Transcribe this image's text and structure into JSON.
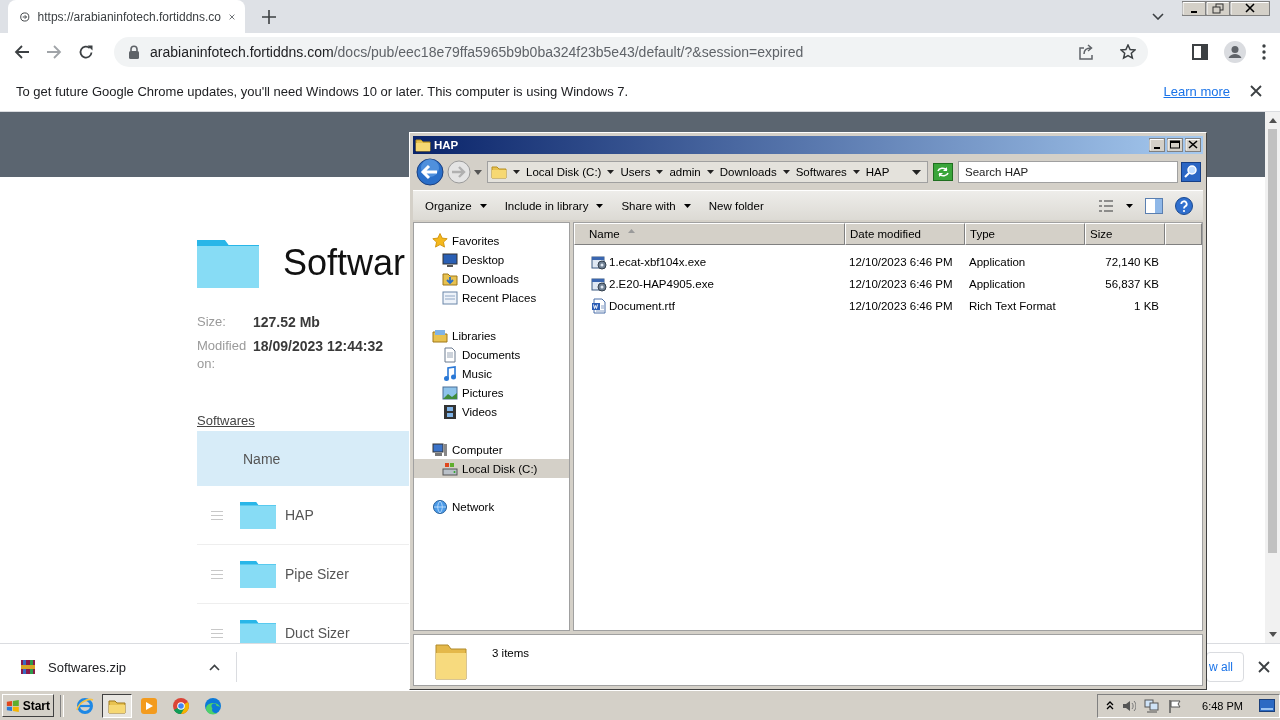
{
  "browser": {
    "tab": {
      "title": "https://arabianinfotech.fortiddns.co"
    },
    "address": {
      "host": "arabianinfotech.fortiddns.com",
      "path": "/docs/pub/eec18e79ffa5965b9b0ba324f23b5e43/default/?&session=expired"
    },
    "infobar": {
      "message": "To get future Google Chrome updates, you'll need Windows 10 or later. This computer is using Windows 7.",
      "link": "Learn more"
    }
  },
  "page": {
    "title": "Softwar",
    "size_label": "Size:",
    "size": "127.52 Mb",
    "modified_label": "Modified on:",
    "modified": "18/09/2023 12:44:32",
    "breadcrumb": "Softwares",
    "column": "Name",
    "rows": [
      {
        "name": "HAP"
      },
      {
        "name": "Pipe Sizer"
      },
      {
        "name": "Duct Sizer"
      }
    ]
  },
  "downloads": {
    "file": "Softwares.zip",
    "show_all": "w all"
  },
  "explorer": {
    "title": "HAP",
    "breadcrumb": [
      "Local Disk (C:)",
      "Users",
      "admin",
      "Downloads",
      "Softwares",
      "HAP"
    ],
    "search": {
      "placeholder": "Search HAP"
    },
    "commands": [
      {
        "label": "Organize",
        "menu": true
      },
      {
        "label": "Include in library",
        "menu": true
      },
      {
        "label": "Share with",
        "menu": true
      },
      {
        "label": "New folder",
        "menu": false
      }
    ],
    "nav": [
      {
        "label": "Favorites",
        "selected": false,
        "children": [
          {
            "label": "Desktop",
            "selected": false
          },
          {
            "label": "Downloads",
            "selected": false
          },
          {
            "label": "Recent Places",
            "selected": false
          }
        ]
      },
      {
        "label": "Libraries",
        "selected": false,
        "children": [
          {
            "label": "Documents",
            "selected": false
          },
          {
            "label": "Music",
            "selected": false
          },
          {
            "label": "Pictures",
            "selected": false
          },
          {
            "label": "Videos",
            "selected": false
          }
        ]
      },
      {
        "label": "Computer",
        "selected": false,
        "children": [
          {
            "label": "Local Disk (C:)",
            "selected": true
          }
        ]
      },
      {
        "label": "Network",
        "selected": false
      }
    ],
    "columns": [
      {
        "label": "Name",
        "sorted": true
      },
      {
        "label": "Date modified",
        "sorted": false
      },
      {
        "label": "Type",
        "sorted": false
      },
      {
        "label": "Size",
        "sorted": false
      }
    ],
    "files": [
      {
        "name": "1.ecat-xbf104x.exe",
        "kind": "application",
        "date": "12/10/2023 6:46 PM",
        "type": "Application",
        "size": "72,140 KB"
      },
      {
        "name": "2.E20-HAP4905.exe",
        "kind": "application",
        "date": "12/10/2023 6:46 PM",
        "type": "Application",
        "size": "56,837 KB"
      },
      {
        "name": "Document.rtf",
        "kind": "document",
        "date": "12/10/2023 6:46 PM",
        "type": "Rich Text Format",
        "size": "1 KB"
      }
    ],
    "status": "3 items"
  },
  "taskbar": {
    "start": "Start",
    "apps": [
      {
        "kind": "ie",
        "active": false
      },
      {
        "kind": "explorer",
        "active": true
      },
      {
        "kind": "media",
        "active": false
      },
      {
        "kind": "chrome",
        "active": false
      },
      {
        "kind": "edge",
        "active": false
      }
    ],
    "clock": "6:48 PM"
  }
}
